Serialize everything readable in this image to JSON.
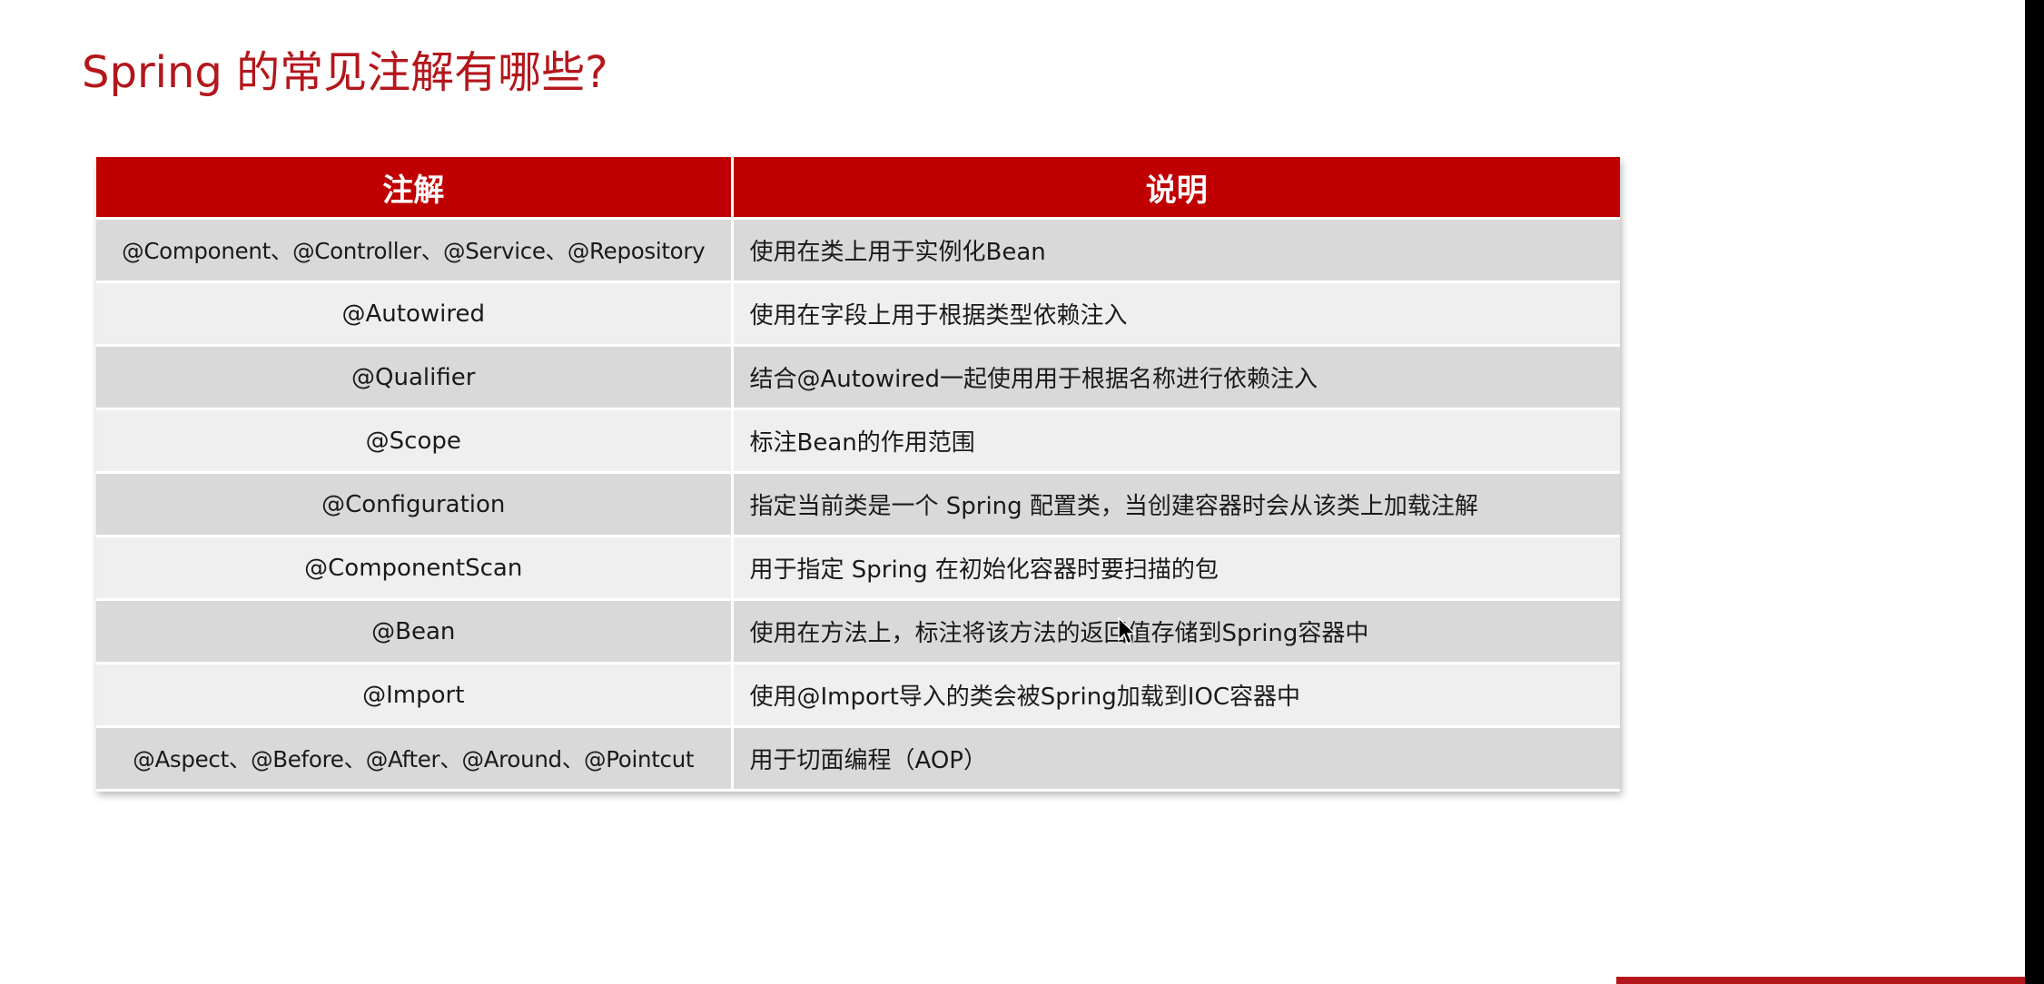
{
  "title": "Spring 的常见注解有哪些?",
  "table": {
    "headers": [
      "注解",
      "说明"
    ],
    "rows": [
      {
        "annotation": "@Component、@Controller、@Service、@Repository",
        "description": "使用在类上用于实例化Bean"
      },
      {
        "annotation": "@Autowired",
        "description": "使用在字段上用于根据类型依赖注入"
      },
      {
        "annotation": "@Qualifier",
        "description": "结合@Autowired一起使用用于根据名称进行依赖注入"
      },
      {
        "annotation": "@Scope",
        "description": "标注Bean的作用范围"
      },
      {
        "annotation": "@Configuration",
        "description": "指定当前类是一个 Spring 配置类，当创建容器时会从该类上加载注解"
      },
      {
        "annotation": "@ComponentScan",
        "description": "用于指定 Spring  在初始化容器时要扫描的包"
      },
      {
        "annotation": "@Bean",
        "description": "使用在方法上，标注将该方法的返回值存储到Spring容器中"
      },
      {
        "annotation": "@Import",
        "description": "使用@Import导入的类会被Spring加载到IOC容器中"
      },
      {
        "annotation": "@Aspect、@Before、@After、@Around、@Pointcut",
        "description": "用于切面编程（AOP）"
      }
    ]
  },
  "colors": {
    "title": "#b3171c",
    "header_bg": "#c00000",
    "row_odd": "#d9d9d9",
    "row_even": "#efefef"
  }
}
